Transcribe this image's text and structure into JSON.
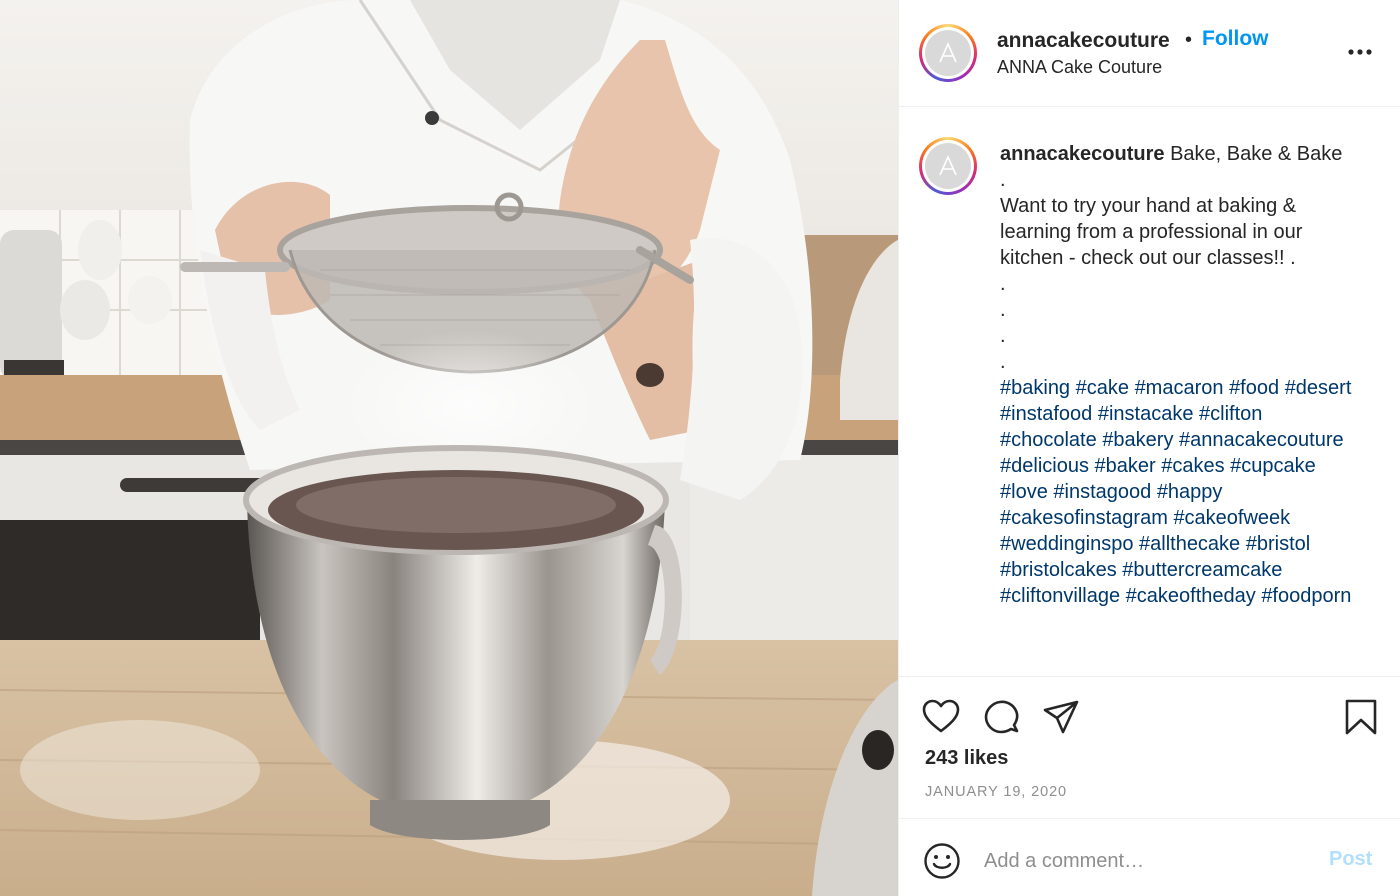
{
  "post": {
    "username": "annacakecouture",
    "separator": "•",
    "follow_label": "Follow",
    "subtitle": "ANNA Cake Couture",
    "more_icon": "more-horizontal-icon"
  },
  "caption": {
    "username": "annacakecouture",
    "lines": [
      " Bake, Bake & Bake",
      ".",
      "Want to try your hand at baking & learning from a professional in our kitchen - check out our classes!! .",
      ".",
      ".",
      ".",
      "."
    ],
    "hashtags": [
      "#baking",
      "#cake",
      "#macaron",
      "#food",
      "#desert",
      "#instafood",
      "#instacake",
      "#clifton",
      "#chocolate",
      "#bakery",
      "#annacakecouture",
      "#delicious",
      "#baker",
      "#cakes",
      "#cupcake",
      "#love",
      "#instagood",
      "#happy",
      "#cakesofinstagram",
      "#cakeofweek",
      "#weddinginspo",
      "#allthecake",
      "#bristol",
      "#bristolcakes",
      "#buttercreamcake",
      "#cliftonvillage",
      "#cakeoftheday",
      "#foodporn"
    ]
  },
  "actions": {
    "like_icon": "heart-icon",
    "comment_icon": "comment-icon",
    "share_icon": "share-icon",
    "save_icon": "bookmark-icon",
    "likes": "243 likes",
    "date": "JANUARY 19, 2020"
  },
  "comment": {
    "emoji_icon": "smiley-icon",
    "placeholder": "Add a comment…",
    "post_label": "Post"
  },
  "colors": {
    "link": "#0095f6",
    "hashtag": "#00376b",
    "post_disabled": "#b2dffc",
    "muted": "#8e8e8e"
  }
}
